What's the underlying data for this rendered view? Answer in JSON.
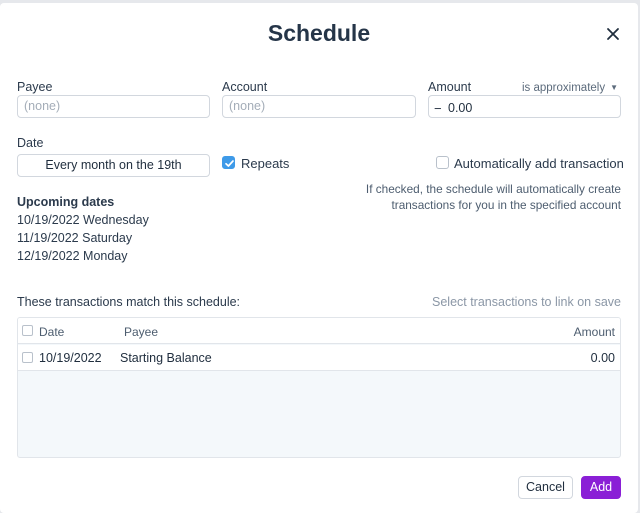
{
  "title": "Schedule",
  "fields": {
    "payee_label": "Payee",
    "payee_placeholder": "(none)",
    "account_label": "Account",
    "account_placeholder": "(none)",
    "amount_label": "Amount",
    "amount_mode": "is approximately",
    "amount_sign": "−",
    "amount_value": "0.00",
    "date_label": "Date",
    "date_value": "Every month on the 19th",
    "repeats_label": "Repeats",
    "repeats_checked": true,
    "auto_add_label": "Automatically add transaction",
    "auto_add_checked": false,
    "auto_add_help": "If checked, the schedule will automatically create transactions for you in the specified account"
  },
  "upcoming": {
    "title": "Upcoming dates",
    "dates": [
      "10/19/2022 Wednesday",
      "11/19/2022 Saturday",
      "12/19/2022 Monday"
    ]
  },
  "matches": {
    "title": "These transactions match this schedule:",
    "hint": "Select transactions to link on save",
    "columns": {
      "date": "Date",
      "payee": "Payee",
      "amount": "Amount"
    },
    "rows": [
      {
        "date": "10/19/2022",
        "payee": "Starting Balance",
        "amount": "0.00"
      }
    ]
  },
  "actions": {
    "cancel": "Cancel",
    "add": "Add"
  },
  "colors": {
    "accent": "#8a1fd6",
    "checkbox": "#3e9ae8"
  }
}
